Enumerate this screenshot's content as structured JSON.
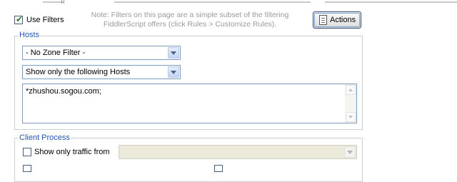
{
  "use_filters": {
    "label": "Use Filters",
    "checked": true
  },
  "note": {
    "line1": "Note: Filters on this page are a simple subset of the filtering",
    "line2": "FiddlerScript offers (click Rules > Customize Rules)."
  },
  "actions_button": {
    "label": "Actions",
    "icon": "document-icon"
  },
  "hosts": {
    "title": "Hosts",
    "zone_filter": "- No Zone Filter -",
    "host_filter": "Show only the following Hosts",
    "host_list": "*zhushou.sogou.com;"
  },
  "client_process": {
    "title": "Client Process",
    "show_only_traffic_from": {
      "label": "Show only traffic from",
      "checked": false
    },
    "process_value": ""
  }
}
